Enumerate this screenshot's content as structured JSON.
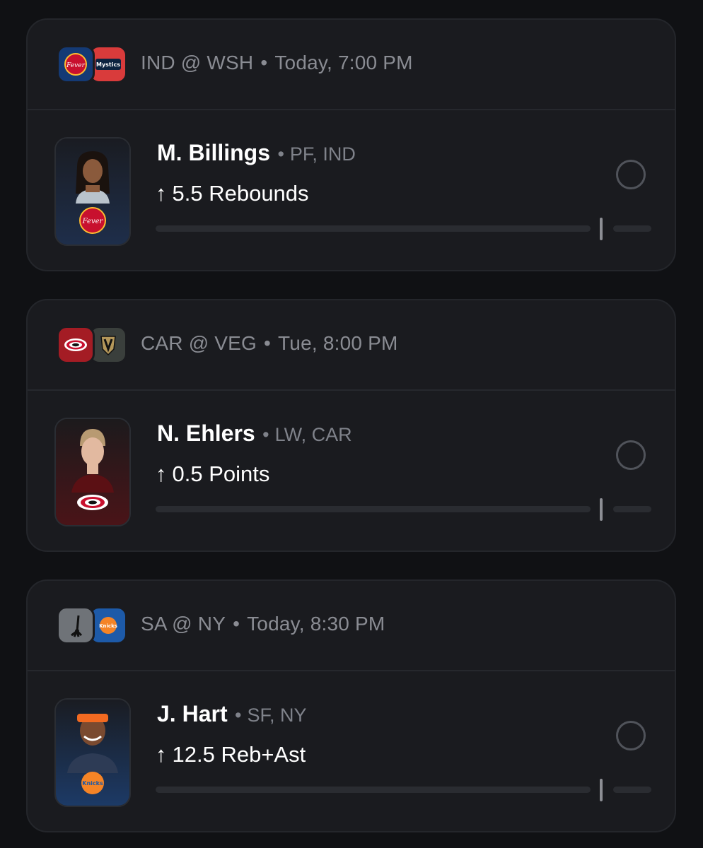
{
  "props": [
    {
      "matchup": "IND @ WSH",
      "time": "Today, 7:00 PM",
      "away_team": {
        "abbr": "IND",
        "logo_icon": "fever-logo-icon",
        "color": "#143a75",
        "text": "Fever"
      },
      "home_team": {
        "abbr": "WSH",
        "logo_icon": "mystics-logo-icon",
        "color": "#d93b3b",
        "text": "Mystics"
      },
      "player_name": "M. Billings",
      "position": "PF, IND",
      "direction_icon": "arrow-up-icon",
      "line": "5.5 Rebounds",
      "photo_bg": "#1e2e4a",
      "photo_team_logo": "fever-logo-icon",
      "progress": 0.0
    },
    {
      "matchup": "CAR @ VEG",
      "time": "Tue, 8:00 PM",
      "away_team": {
        "abbr": "CAR",
        "logo_icon": "hurricanes-logo-icon",
        "color": "#a41c24",
        "text": ""
      },
      "home_team": {
        "abbr": "VEG",
        "logo_icon": "golden-knights-logo-icon",
        "color": "#3a3f3c",
        "text": ""
      },
      "player_name": "N. Ehlers",
      "position": "LW, CAR",
      "direction_icon": "arrow-up-icon",
      "line": "0.5 Points",
      "photo_bg": "#4a1418",
      "photo_team_logo": "hurricanes-logo-icon",
      "progress": 0.0
    },
    {
      "matchup": "SA @ NY",
      "time": "Today, 8:30 PM",
      "away_team": {
        "abbr": "SA",
        "logo_icon": "spurs-logo-icon",
        "color": "#6f7378",
        "text": ""
      },
      "home_team": {
        "abbr": "NY",
        "logo_icon": "knicks-logo-icon",
        "color": "#1d5aa8",
        "text": "Knicks"
      },
      "player_name": "J. Hart",
      "position": "SF, NY",
      "direction_icon": "arrow-up-icon",
      "line": "12.5 Reb+Ast",
      "photo_bg": "#1c3a66",
      "photo_team_logo": "knicks-logo-icon",
      "progress": 0.0
    }
  ],
  "separator": "•",
  "arrow_glyph": "↑"
}
